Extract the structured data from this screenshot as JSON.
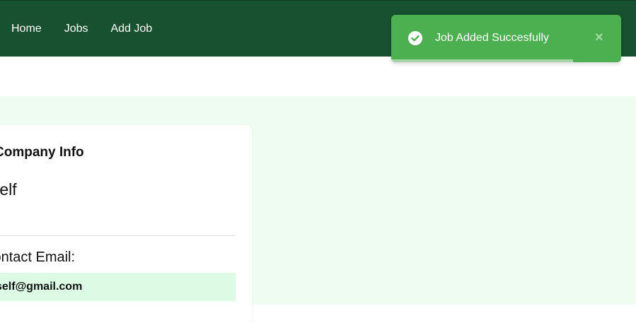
{
  "nav": {
    "items": [
      {
        "label": "Home"
      },
      {
        "label": "Jobs"
      },
      {
        "label": "Add Job"
      }
    ]
  },
  "toast": {
    "message": "Job Added Succesfully",
    "close_symbol": "×",
    "icon": "check-circle-icon",
    "progress_fraction": 0.79,
    "color": "#4caf50"
  },
  "company_card": {
    "heading": "Company Info",
    "name": "Self",
    "email_label": "Contact Email:",
    "email": "self@gmail.com"
  },
  "colors": {
    "navbar": "#175130",
    "content_background": "#effcf2",
    "email_highlight": "#dcfae4"
  }
}
